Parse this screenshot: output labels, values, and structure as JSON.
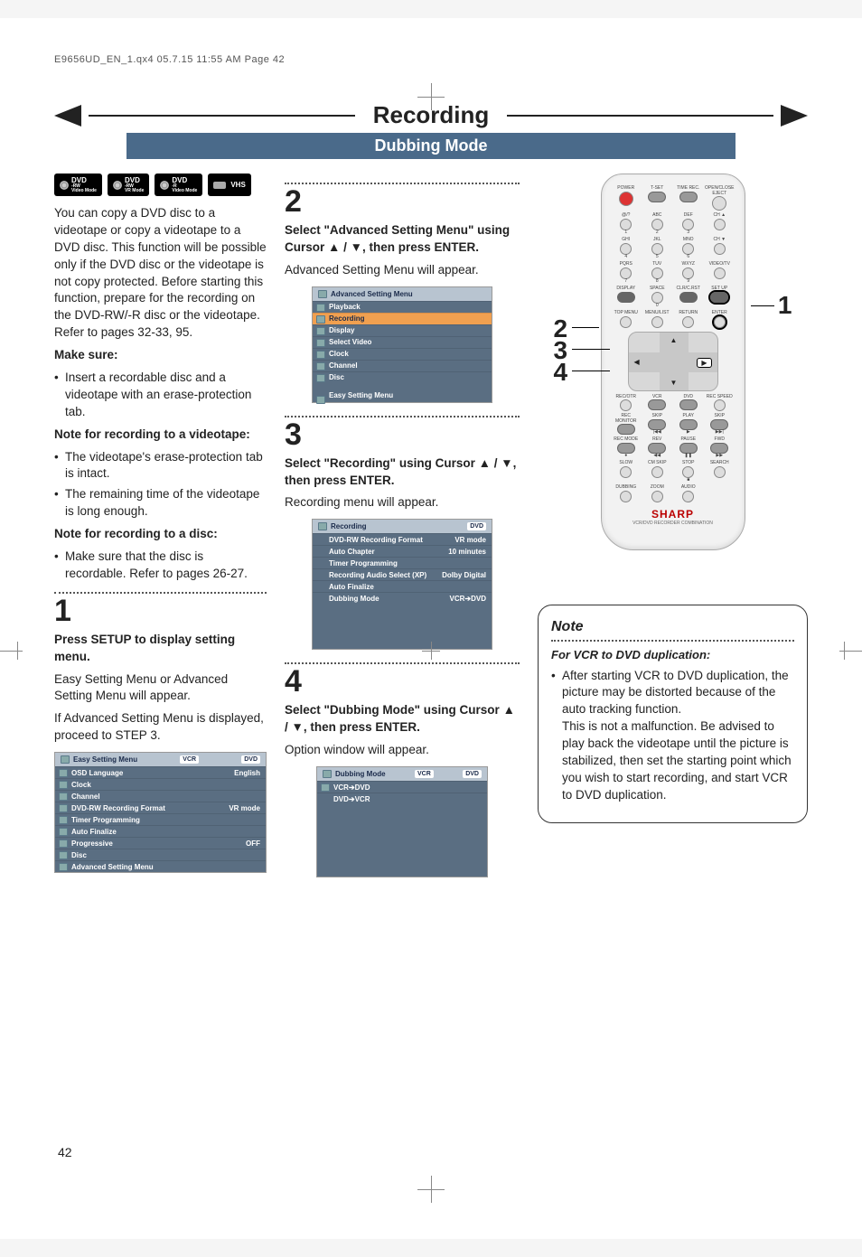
{
  "header": "E9656UD_EN_1.qx4  05.7.15  11:55 AM  Page 42",
  "banner": {
    "title": "Recording",
    "subtitle": "Dubbing Mode"
  },
  "badges": {
    "b1": {
      "top": "DVD",
      "sub": "-RW",
      "mode": "Video Mode"
    },
    "b2": {
      "top": "DVD",
      "sub": "-RW",
      "mode": "VR Mode"
    },
    "b3": {
      "top": "DVD",
      "sub": "-R",
      "mode": "Video Mode"
    },
    "b4": "VHS"
  },
  "intro": {
    "p1": "You can copy a DVD disc to a videotape or copy a videotape to a DVD disc. This function will be possible only if the DVD disc or the videotape is not copy protected. Before starting this function, prepare for the recording on the DVD-RW/-R disc or the videotape. Refer to pages 32-33, 95.",
    "makeSureTitle": "Make sure:",
    "makeSure1": "Insert a recordable disc and a videotape with an erase-protection tab.",
    "noteVtTitle": "Note for recording to a videotape:",
    "noteVt1": "The videotape's erase-protection tab is intact.",
    "noteVt2": "The remaining time of the videotape is long enough.",
    "noteDiscTitle": "Note for recording to a disc:",
    "noteDisc1": "Make sure that the disc is recordable. Refer to pages 26-27."
  },
  "step1": {
    "num": "1",
    "instr": "Press SETUP to display setting menu.",
    "body1": "Easy Setting Menu or Advanced Setting Menu will appear.",
    "body2": "If Advanced Setting Menu is displayed, proceed to STEP 3.",
    "menu": {
      "title": "Easy Setting Menu",
      "badge1": "VCR",
      "badge2": "DVD",
      "rows": [
        {
          "l": "OSD Language",
          "r": "English"
        },
        {
          "l": "Clock",
          "r": ""
        },
        {
          "l": "Channel",
          "r": ""
        },
        {
          "l": "DVD-RW Recording Format",
          "r": "VR mode"
        },
        {
          "l": "Timer Programming",
          "r": ""
        },
        {
          "l": "Auto Finalize",
          "r": ""
        },
        {
          "l": "Progressive",
          "r": "OFF"
        },
        {
          "l": "Disc",
          "r": ""
        },
        {
          "l": "Advanced Setting Menu",
          "r": ""
        }
      ]
    }
  },
  "step2": {
    "num": "2",
    "instr": "Select \"Advanced Setting Menu\" using Cursor ▲ / ▼, then press ENTER.",
    "body": "Advanced Setting Menu will appear.",
    "menu": {
      "title": "Advanced Setting Menu",
      "rows": [
        "Playback",
        "Recording",
        "Display",
        "Select Video",
        "Clock",
        "Channel",
        "Disc"
      ],
      "easy": "Easy Setting Menu",
      "hl": 1
    }
  },
  "step3": {
    "num": "3",
    "instr": "Select \"Recording\" using Cursor ▲ / ▼, then press ENTER.",
    "body": "Recording menu will appear.",
    "menu": {
      "title": "Recording",
      "badge": "DVD",
      "rows": [
        {
          "l": "DVD-RW Recording Format",
          "r": "VR mode"
        },
        {
          "l": "Auto Chapter",
          "r": "10 minutes"
        },
        {
          "l": "Timer Programming",
          "r": ""
        },
        {
          "l": "Recording Audio Select (XP)",
          "r": "Dolby Digital"
        },
        {
          "l": "Auto Finalize",
          "r": ""
        },
        {
          "l": "Dubbing Mode",
          "r": "VCR➔DVD"
        }
      ]
    }
  },
  "step4": {
    "num": "4",
    "instr": "Select \"Dubbing Mode\" using Cursor ▲ / ▼, then press ENTER.",
    "body": "Option window will appear.",
    "menu": {
      "title": "Dubbing Mode",
      "badge1": "VCR",
      "badge2": "DVD",
      "rows": [
        "VCR➔DVD",
        "DVD➔VCR"
      ]
    }
  },
  "remote": {
    "brand": "SHARP",
    "brandSub": "VCR/DVD RECORDER COMBINATION",
    "row0": {
      "a": "POWER",
      "b": "T-SET",
      "c": "TIME REC.",
      "d": "OPEN/CLOSE EJECT"
    },
    "row1": {
      "a": "@/?",
      "b": "ABC",
      "c": "DEF",
      "d": ""
    },
    "row1n": {
      "a": "1",
      "b": "2",
      "c": "3",
      "d": "CH ▲"
    },
    "row2": {
      "a": "GHI",
      "b": "JKL",
      "c": "MNO",
      "d": ""
    },
    "row2n": {
      "a": "4",
      "b": "5",
      "c": "6",
      "d": "CH ▼"
    },
    "row3": {
      "a": "PQRS",
      "b": "TUV",
      "c": "WXYZ",
      "d": "VIDEO/TV"
    },
    "row3n": {
      "a": "7",
      "b": "8",
      "c": "9",
      "d": ""
    },
    "row4": {
      "a": "DISPLAY",
      "b": "SPACE",
      "c": "CLR/C.RST",
      "d": "SET UP"
    },
    "row4n": {
      "a": "",
      "b": "0",
      "c": "",
      "d": ""
    },
    "row5": {
      "a": "TOP MENU",
      "b": "MENU/LIST",
      "c": "RETURN",
      "d": "ENTER"
    },
    "play": "▶",
    "row6": {
      "a": "REC/OTR",
      "b": "VCR",
      "c": "DVD",
      "d": "REC SPEED"
    },
    "row7": {
      "a": "REC MONITOR",
      "b": "SKIP",
      "c": "PLAY",
      "d": "SKIP"
    },
    "row7b": {
      "a": "",
      "b": "|◀◀",
      "c": "▶",
      "d": "▶▶|"
    },
    "row8": {
      "a": "REC MODE",
      "b": "REV",
      "c": "PAUSE",
      "d": "FWD"
    },
    "row8b": {
      "a": "●",
      "b": "◀◀",
      "c": "❚❚",
      "d": "▶▶"
    },
    "row9": {
      "a": "SLOW",
      "b": "CM SKIP",
      "c": "STOP",
      "d": "SEARCH"
    },
    "row9b": {
      "a": "",
      "b": "",
      "c": "■",
      "d": ""
    },
    "row10": {
      "a": "DUBBING",
      "b": "ZOOM",
      "c": "AUDIO",
      "d": ""
    }
  },
  "callouts": {
    "c1": "1",
    "c2": "2",
    "c3": "3",
    "c4": "4"
  },
  "note": {
    "title": "Note",
    "sub": "For VCR to DVD duplication:",
    "body": "After starting VCR to DVD duplication, the picture may be distorted because of the auto tracking function.\nThis is not a malfunction. Be advised to play back the videotape until the picture is stabilized, then set the starting point which you wish to start recording, and start VCR to DVD duplication."
  },
  "pageNum": "42"
}
